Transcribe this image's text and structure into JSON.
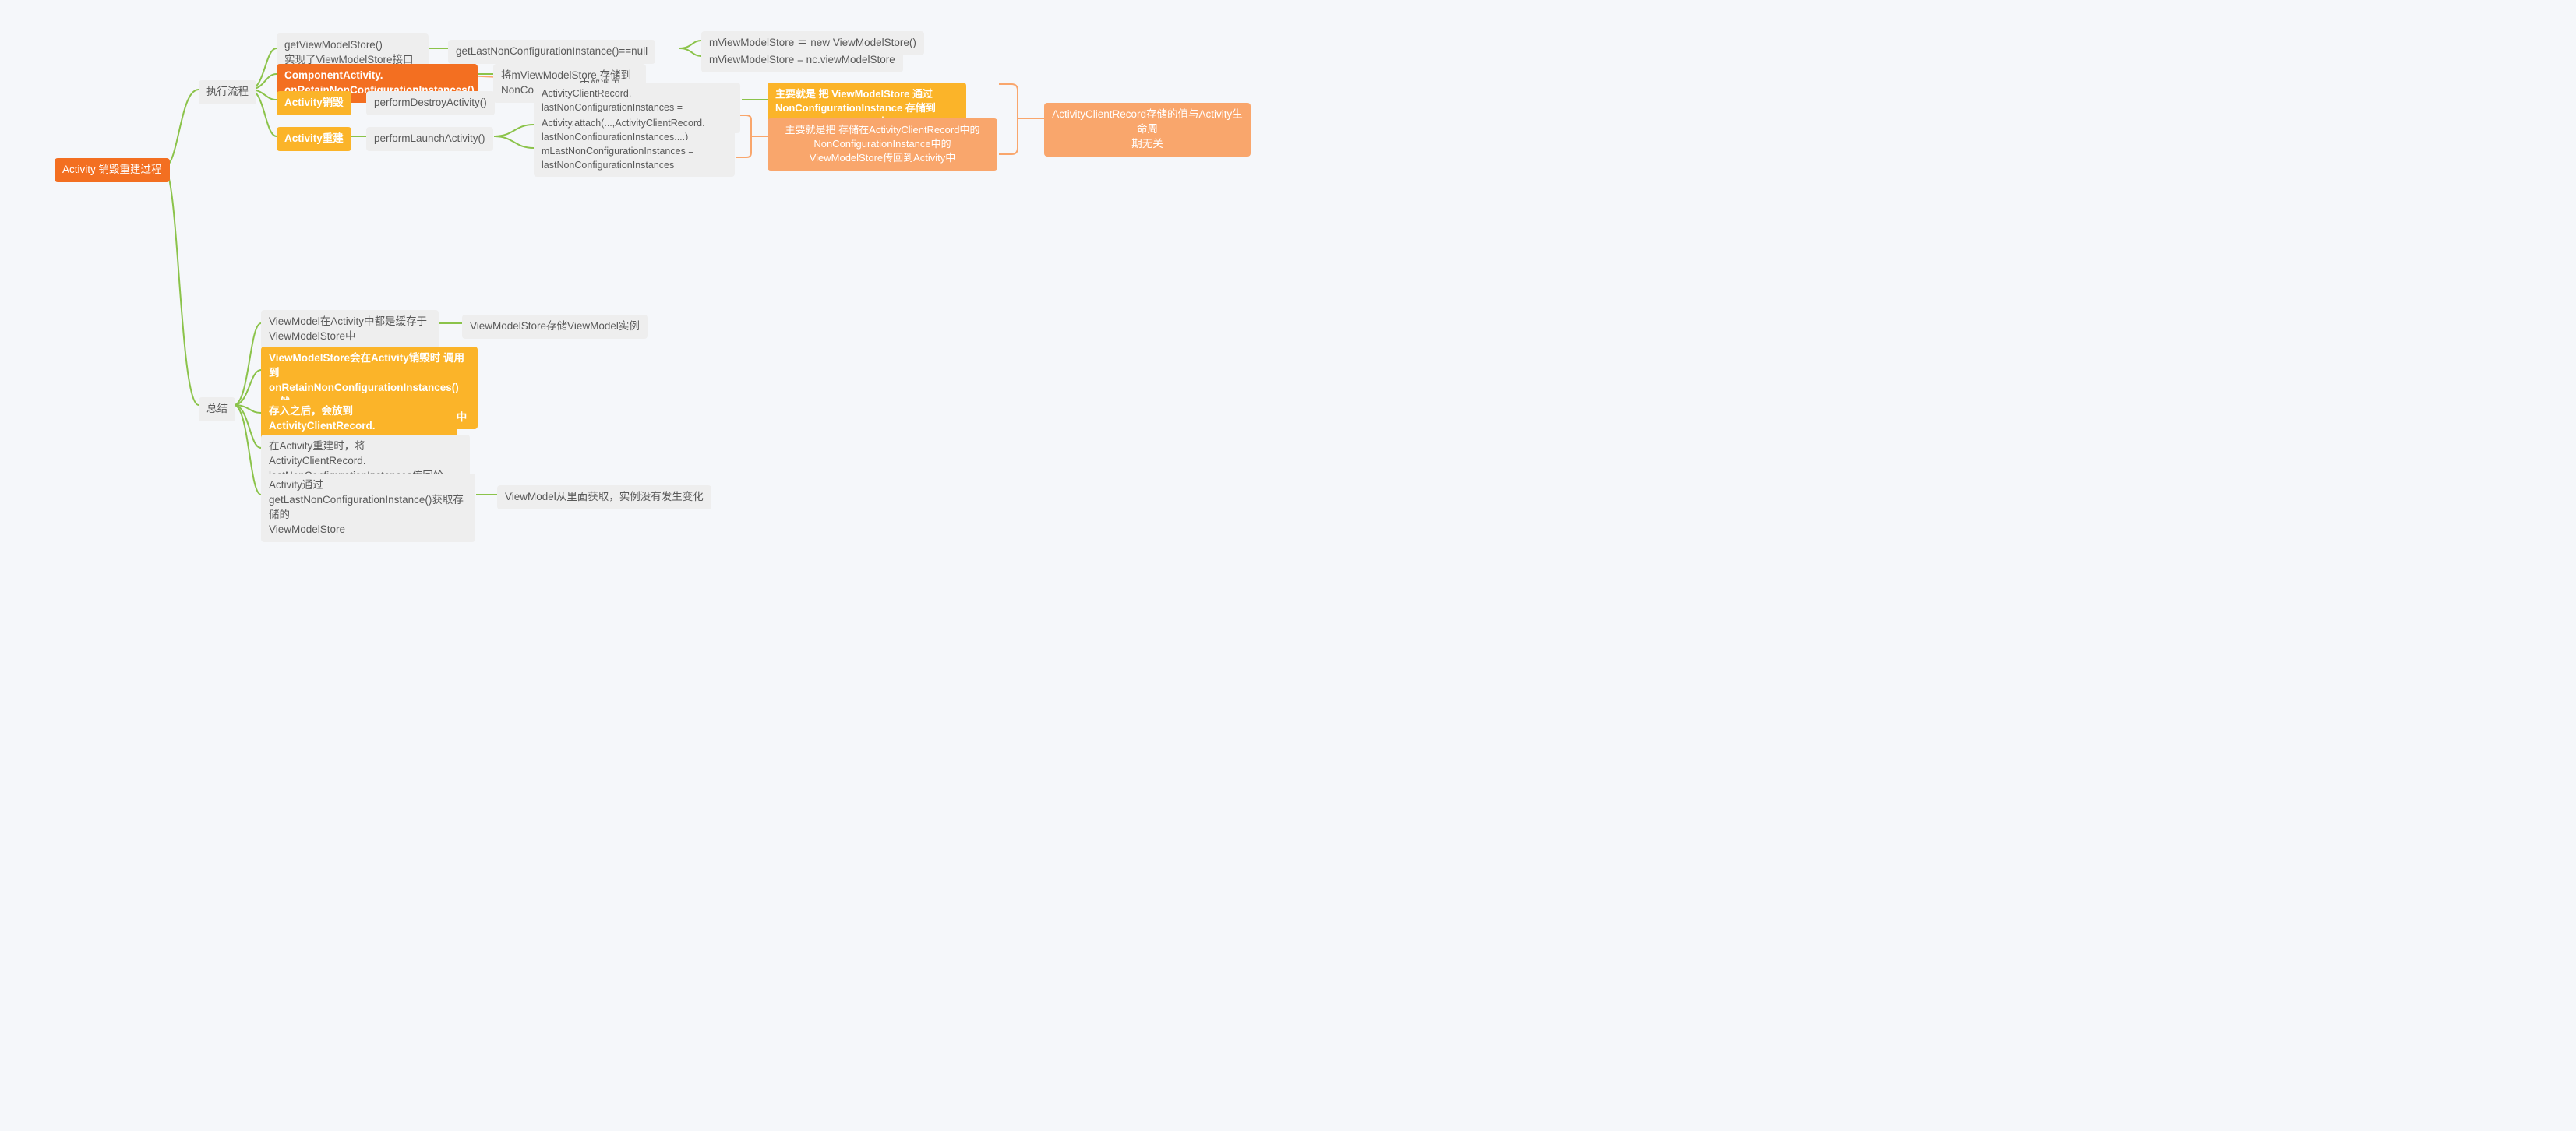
{
  "root": "Activity 销毁重建过程",
  "exec_flow": "执行流程",
  "summary": "总结",
  "node_getVMS": "getViewModelStore()\n实现了ViewModelStore接口",
  "node_getLastNull": "getLastNonConfigurationInstance()==null",
  "node_newVMS": "mViewModelStore ＝ new ViewModelStore()",
  "node_ncVMS": "mViewModelStore = nc.viewModelStore",
  "node_component": "ComponentActivity.\nonRetainNonConfigurationInstances()",
  "node_storeVMS": "将mViewModelStore 存储到\nNonConfigurationInstances中",
  "node_destroy": "Activity销毁",
  "node_performDestroy": "performDestroyActivity()",
  "node_internalCall": "内部调用",
  "node_acrLast": "ActivityClientRecord.\nlastNonConfigurationInstances = \nactivity.retainNonConfigurationInstances()",
  "node_mainStore": "主要就是 把 ViewModelStore 通过\nNonConfigurationInstance 存储到\nActivityCliientRecord中",
  "node_rebuild": "Activity重建",
  "node_performLaunch": "performLaunchActivity()",
  "node_attach": "Activity.attach(...,ActivityClientRecord.\nlastNonConfigurationInstances,...)",
  "node_mLast": "mLastNonConfigurationInstances = \nlastNonConfigurationInstances",
  "node_mainReturn": "主要就是把 存储在ActivityClientRecord中的\nNonConfigurationInstance中的\nViewModelStore传回到Activity中",
  "node_acrLife": "ActivityClientRecord存储的值与Activity生命周\n期无关",
  "sum1": "ViewModel在Activity中都是缓存于\nViewModelStore中",
  "sum1child": "ViewModelStore存储ViewModel实例",
  "sum2": "ViewModelStore会在Activity销毁时 调用到\nonRetainNonConfigurationInstances()  ，然\n后被存入到 NonConfigurationInstance中",
  "sum3": "存入之后，会放到ActivityClientRecord.\nlastNonConfigurationInstances中",
  "sum4": "在Activity重建时，将ActivityClientRecord.\nlastNonConfigurationInstances传回给Activity",
  "sum5": "Activity通过\ngetLastNonConfigurationInstance()获取存储的\nViewModelStore",
  "sum5child": "ViewModel从里面获取，实例没有发生变化"
}
